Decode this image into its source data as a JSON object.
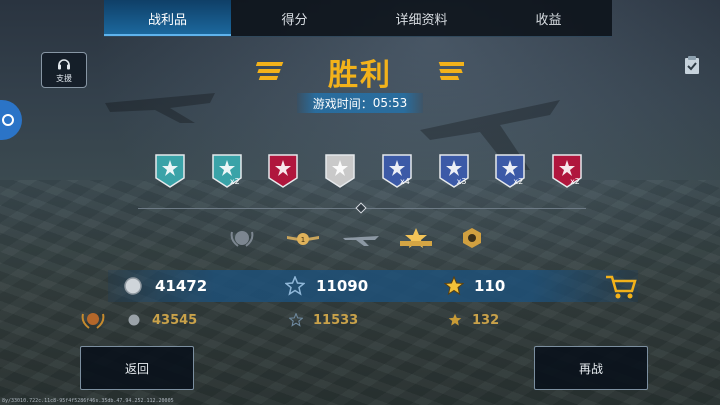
{
  "tabs": [
    "战利品",
    "得分",
    "详细资料",
    "收益"
  ],
  "support_label": "支援",
  "result_title": "胜利",
  "time_label": "游戏时间：",
  "time_value": "05:53",
  "medals": [
    {
      "color": "#3aa3a8",
      "icon": "double-star-medal-icon",
      "mult": ""
    },
    {
      "color": "#3aa3a8",
      "icon": "double-star-medal-icon",
      "mult": "x2"
    },
    {
      "color": "#b0163d",
      "icon": "star-medal-icon",
      "mult": ""
    },
    {
      "color": "#c9c9c9",
      "icon": "shield-medal-icon",
      "mult": ""
    },
    {
      "color": "#3c5aa7",
      "icon": "plane-medal-icon",
      "mult": "x4"
    },
    {
      "color": "#3c5aa7",
      "icon": "plane-medal-icon",
      "mult": "x3"
    },
    {
      "color": "#3c5aa7",
      "icon": "parachute-medal-icon",
      "mult": "x2"
    },
    {
      "color": "#b0163d",
      "icon": "star-medal-icon",
      "mult": "x2"
    }
  ],
  "rewards": {
    "silver": "41472",
    "xp": "11090",
    "gold_star": "110",
    "silver_total": "43545",
    "xp_total": "11533",
    "gold_star_total": "132"
  },
  "buttons": {
    "back": "返回",
    "again": "再战"
  },
  "footer_text": "8y/33010.722c.11c8-95f4f5286f46s.35db.47.94.252.112.20005",
  "colors": {
    "accent": "#f3b21a",
    "tab_active": "#1c6aa0",
    "row": "#1e5078"
  }
}
